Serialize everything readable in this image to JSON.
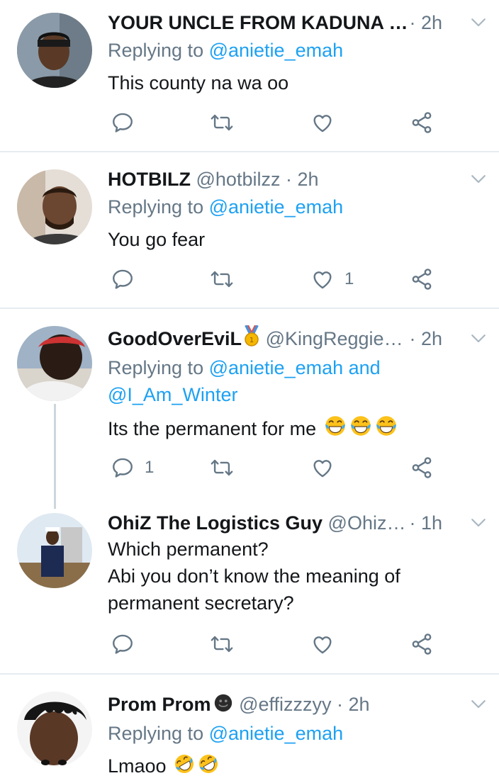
{
  "tweets": [
    {
      "name": "YOUR UNCLE FROM KADUNA …",
      "handle": "",
      "time": "· 2h",
      "replying_prefix": "Replying to ",
      "replying_to": "@anietie_emah",
      "text": [
        "This county na wa oo"
      ],
      "actions": {
        "reply": "",
        "retweet": "",
        "like": "",
        "share": ""
      }
    },
    {
      "name": "HOTBILZ",
      "handle": "@hotbilzz",
      "time": "· 2h",
      "replying_prefix": "Replying to ",
      "replying_to": "@anietie_emah",
      "text": [
        "You go fear"
      ],
      "actions": {
        "reply": "",
        "retweet": "",
        "like": "1",
        "share": ""
      }
    },
    {
      "name": "GoodOverEviL",
      "handle": "@KingReggie…",
      "time": "· 2h",
      "replying_prefix": "Replying to ",
      "replying_to": "@anietie_emah and",
      "replying_to_2": "@I_Am_Winter",
      "text": [
        "Its the permanent for me"
      ],
      "actions": {
        "reply": "1",
        "retweet": "",
        "like": "",
        "share": ""
      }
    },
    {
      "name": "OhiZ The Logistics Guy",
      "handle": "@Ohiz…",
      "time": "· 1h",
      "text": [
        "Which permanent?",
        "Abi you don’t know the meaning of",
        "permanent secretary?"
      ],
      "actions": {
        "reply": "",
        "retweet": "",
        "like": "",
        "share": ""
      }
    },
    {
      "name": "Prom Prom",
      "handle": "@effizzzyy",
      "time": "· 2h",
      "replying_prefix": "Replying to ",
      "replying_to": "@anietie_emah",
      "text": [
        "Lmaoo"
      ]
    }
  ],
  "colors": {
    "link": "#1da1f2",
    "muted": "#657786",
    "icon": "#657786",
    "divider": "#e6ecf0",
    "thread_line": "#ccd6dd"
  },
  "icons": {
    "reply": "reply-icon",
    "retweet": "retweet-icon",
    "like": "like-icon",
    "share": "share-icon",
    "caret": "chevron-down-icon",
    "badge": "medal-icon",
    "laugh": "tears-of-joy-emoji",
    "rofl": "rofl-emoji",
    "smiley": "smiley-emoji"
  }
}
